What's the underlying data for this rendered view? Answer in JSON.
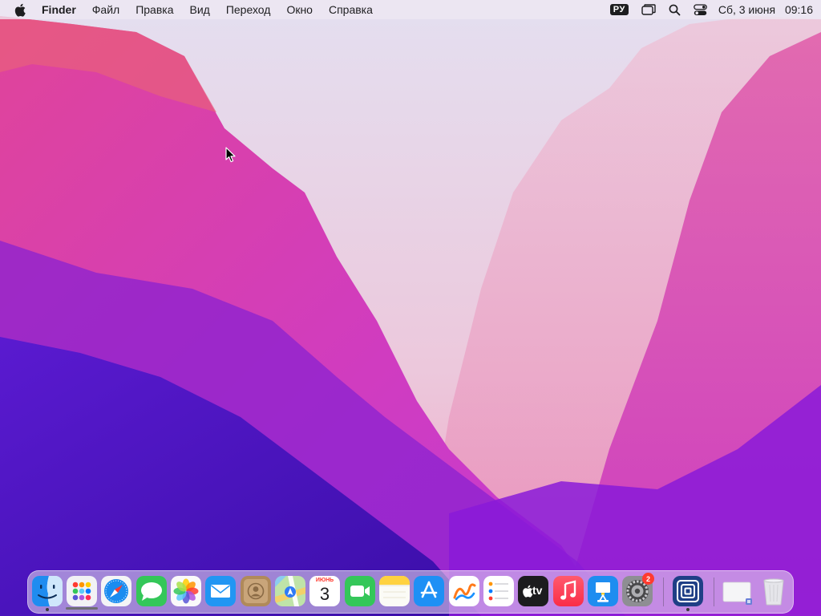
{
  "menubar": {
    "app_name": "Finder",
    "menus": [
      "Файл",
      "Правка",
      "Вид",
      "Переход",
      "Окно",
      "Справка"
    ],
    "input_source": "РУ",
    "date": "Сб, 3 июня",
    "time": "09:16"
  },
  "icons": {
    "apple": "apple-icon",
    "stage_manager": "stage-manager-icon",
    "spotlight": "search-icon",
    "control_center": "control-center-icon"
  },
  "dock": {
    "apps": [
      {
        "name": "Finder",
        "running": true
      },
      {
        "name": "Launchpad",
        "running": false
      },
      {
        "name": "Safari",
        "running": false
      },
      {
        "name": "Messages",
        "running": false
      },
      {
        "name": "Photos",
        "running": false
      },
      {
        "name": "Mail",
        "running": false
      },
      {
        "name": "Contacts",
        "running": false
      },
      {
        "name": "Maps",
        "running": false
      },
      {
        "name": "Calendar",
        "running": false
      },
      {
        "name": "FaceTime",
        "running": false
      },
      {
        "name": "Notes",
        "running": false
      },
      {
        "name": "App Store",
        "running": false
      },
      {
        "name": "Freeform",
        "running": false
      },
      {
        "name": "Reminders",
        "running": false
      },
      {
        "name": "Apple TV",
        "running": false
      },
      {
        "name": "Music",
        "running": false
      },
      {
        "name": "Keynote",
        "running": false
      },
      {
        "name": "System Settings",
        "running": false
      },
      {
        "name": "Screen Sharing",
        "running": true
      }
    ],
    "calendar_month": "ИЮНЬ",
    "calendar_day": "3",
    "tv_label": "tv",
    "settings_badge": "2"
  },
  "colors": {
    "menubar_bg": "#eee8f2",
    "badge": "#ff3b30",
    "wallpaper_top": "#e4def0",
    "wallpaper_magenta": "#d63bb8",
    "wallpaper_violet": "#4a14c8"
  }
}
